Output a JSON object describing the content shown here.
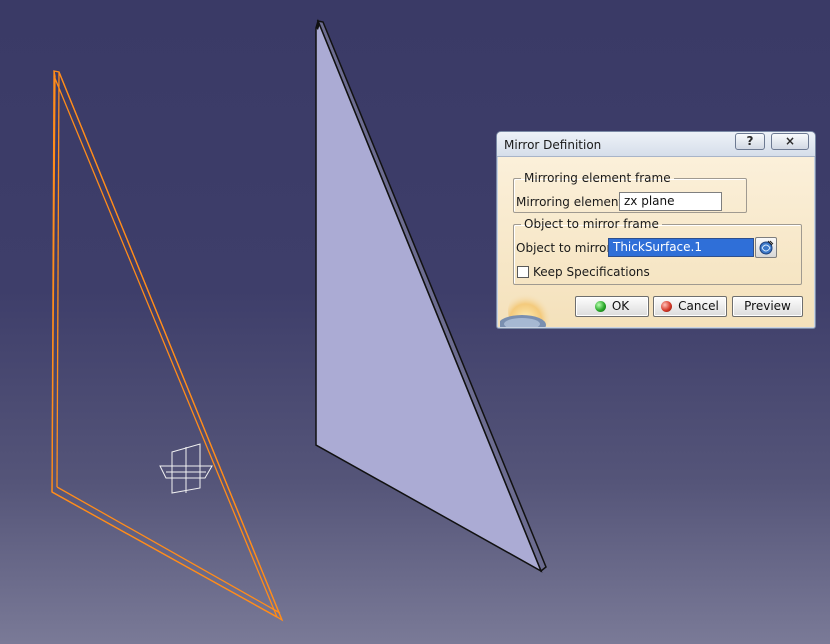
{
  "dialog": {
    "title": "Mirror Definition",
    "help_label": "?",
    "close_label": "×",
    "mirroring_frame": {
      "legend": "Mirroring element frame",
      "label": "Mirroring element:",
      "value": "zx plane"
    },
    "object_frame": {
      "legend": "Object to mirror frame",
      "label": "Object to mirror:",
      "value": "ThickSurface.1",
      "keep_spec_label": "Keep Specifications",
      "keep_spec_checked": false
    },
    "buttons": {
      "ok": "OK",
      "cancel": "Cancel",
      "preview": "Preview"
    }
  },
  "icons": {
    "ok": "ok-green-icon",
    "cancel": "cancel-red-icon",
    "select": "select-element-icon",
    "compass": "plane-compass-icon",
    "globe": "catia-globe-icon"
  },
  "colors": {
    "background_top": "#3a3a66",
    "background_bottom": "#7a7a97",
    "wireframe": "#ff8c1a",
    "surface_fill": "#ababd4",
    "dialog_bg": "#f6e4c2",
    "selection": "#2f6fd8"
  }
}
